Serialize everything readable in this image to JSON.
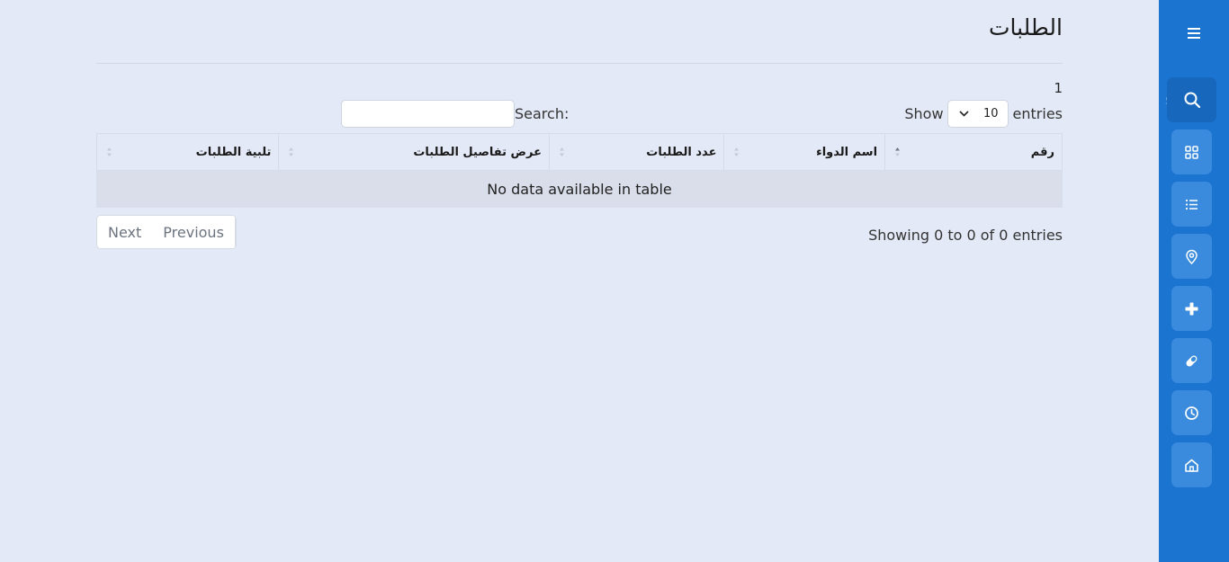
{
  "page": {
    "title": "الطلبات",
    "stray_number": "1"
  },
  "length_control": {
    "show_label": "Show",
    "entries_label": "entries",
    "selected": "10"
  },
  "search": {
    "label": "Search:",
    "value": ""
  },
  "table": {
    "columns": [
      "رقم",
      "اسم الدواء",
      "عدد الطلبات",
      "عرض تفاصيل الطلبات",
      "تلبية الطلبات"
    ],
    "empty_message": "No data available in table"
  },
  "pagination": {
    "next_label": "Next",
    "previous_label": "Previous"
  },
  "info": {
    "text": "Showing 0 to 0 of 0 entries"
  },
  "sidebar": {
    "ghost_text": "s",
    "items": [
      {
        "icon": "menu-icon"
      },
      {
        "icon": "search-icon"
      },
      {
        "icon": "grid-icon"
      },
      {
        "icon": "list-icon"
      },
      {
        "icon": "location-pin-icon"
      },
      {
        "icon": "plus-icon"
      },
      {
        "icon": "pill-icon"
      },
      {
        "icon": "clock-icon"
      },
      {
        "icon": "home-icon"
      }
    ]
  },
  "colors": {
    "sidebar": "#1b74d0",
    "nav_button": "#3a8bdd",
    "background": "#e3e9f6"
  }
}
